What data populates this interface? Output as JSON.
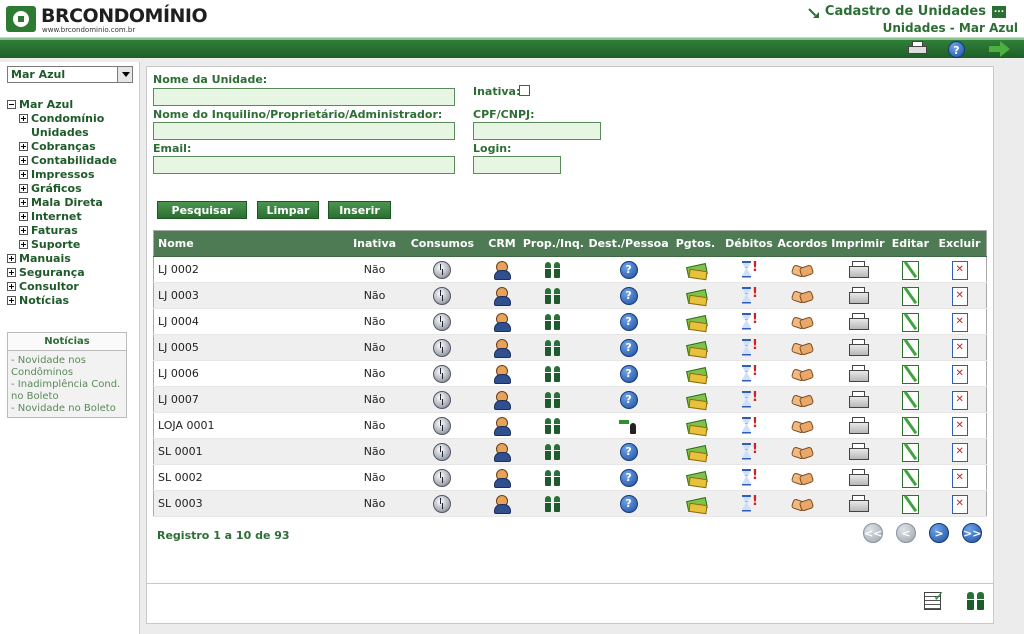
{
  "header": {
    "logo_name": "BRCONDOMÍNIO",
    "logo_url": "www.brcondominio.com.br",
    "title": "Cadastro de Unidades",
    "menu_label": "...",
    "subtitle": "Unidades - Mar Azul",
    "toolbar_icons": [
      "printer-icon",
      "help-icon",
      "exit-icon"
    ]
  },
  "sidebar": {
    "condo_select": "Mar Azul",
    "tree": [
      {
        "label": "Mar Azul",
        "expanded": true,
        "level": 0
      },
      {
        "label": "Condomínio Unidades",
        "expanded": false,
        "level": 1
      },
      {
        "label": "Cobranças",
        "expanded": false,
        "level": 1
      },
      {
        "label": "Contabilidade",
        "expanded": false,
        "level": 1
      },
      {
        "label": "Impressos",
        "expanded": false,
        "level": 1
      },
      {
        "label": "Gráficos",
        "expanded": false,
        "level": 1
      },
      {
        "label": "Mala Direta",
        "expanded": false,
        "level": 1
      },
      {
        "label": "Internet",
        "expanded": false,
        "level": 1
      },
      {
        "label": "Faturas",
        "expanded": false,
        "level": 1
      },
      {
        "label": "Suporte",
        "expanded": false,
        "level": 1
      },
      {
        "label": "Manuais",
        "expanded": false,
        "level": 0
      },
      {
        "label": "Segurança",
        "expanded": false,
        "level": 0
      },
      {
        "label": "Consultor",
        "expanded": false,
        "level": 0
      },
      {
        "label": "Notícias",
        "expanded": false,
        "level": 0
      }
    ],
    "news": {
      "title": "Notícias",
      "items": [
        "- Novidade nos Condôminos",
        "- Inadimplência Cond. no Boleto",
        "- Novidade no Boleto"
      ]
    }
  },
  "form": {
    "nome_unidade_label": "Nome da Unidade:",
    "nome_unidade_value": "",
    "inativa_label": "Inativa:",
    "inativa_checked": false,
    "inquilino_label": "Nome do Inquilino/Proprietário/Administrador:",
    "inquilino_value": "",
    "cpf_label": "CPF/CNPJ:",
    "cpf_value": "",
    "email_label": "Email:",
    "email_value": "",
    "login_label": "Login:",
    "login_value": "",
    "buttons": {
      "search": "Pesquisar",
      "clear": "Limpar",
      "insert": "Inserir"
    }
  },
  "table": {
    "columns": [
      "Nome",
      "Inativa",
      "Consumos",
      "CRM",
      "Prop./Inq.",
      "Dest./Pessoa",
      "Pgtos.",
      "Débitos",
      "Acordos",
      "Imprimir",
      "Editar",
      "Excluir"
    ],
    "rows": [
      {
        "name": "LJ 0002",
        "inativa": "Não",
        "dest": "help-icon"
      },
      {
        "name": "LJ 0003",
        "inativa": "Não",
        "dest": "help-icon"
      },
      {
        "name": "LJ 0004",
        "inativa": "Não",
        "dest": "help-icon"
      },
      {
        "name": "LJ 0005",
        "inativa": "Não",
        "dest": "help-icon"
      },
      {
        "name": "LJ 0006",
        "inativa": "Não",
        "dest": "help-icon"
      },
      {
        "name": "LJ 0007",
        "inativa": "Não",
        "dest": "help-icon"
      },
      {
        "name": "LOJA 0001",
        "inativa": "Não",
        "dest": "destination-person-icon"
      },
      {
        "name": "SL 0001",
        "inativa": "Não",
        "dest": "help-icon"
      },
      {
        "name": "SL 0002",
        "inativa": "Não",
        "dest": "help-icon"
      },
      {
        "name": "SL 0003",
        "inativa": "Não",
        "dest": "help-icon"
      }
    ],
    "record_count": "Registro 1 a 10 de 93"
  },
  "pagination": {
    "first": "<<",
    "prev": "<",
    "next": ">",
    "last": ">>"
  },
  "colors": {
    "brand_green": "#2d6e35",
    "header_green": "#4e7a54",
    "input_bg": "#e6f6e3"
  }
}
